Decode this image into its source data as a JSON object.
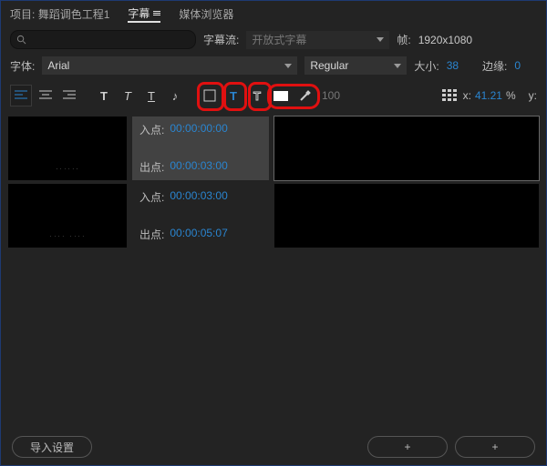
{
  "tabs": {
    "project_label": "项目:",
    "project_name": "舞蹈调色工程1",
    "captions": "字幕",
    "media_browser": "媒体浏览器"
  },
  "search": {
    "placeholder": ""
  },
  "stream": {
    "label": "字幕流:",
    "value": "开放式字幕"
  },
  "frame": {
    "label": "帧:",
    "value": "1920x1080"
  },
  "font": {
    "label": "字体:",
    "family": "Arial",
    "style": "Regular",
    "size_label": "大小:",
    "size": "38",
    "edge_label": "边缘:",
    "edge": "0"
  },
  "pos": {
    "x_label": "x:",
    "x": "41.21",
    "pct": "%",
    "y_label": "y:"
  },
  "opacity": {
    "value": "100"
  },
  "clips": [
    {
      "in_label": "入点:",
      "in": "00:00:00:00",
      "out_label": "出点:",
      "out": "00:00:03:00",
      "text": ""
    },
    {
      "in_label": "入点:",
      "in": "00:00:03:00",
      "out_label": "出点:",
      "out": "00:00:05:07",
      "text": ""
    }
  ],
  "footer": {
    "import": "导入设置",
    "plus": "+"
  }
}
